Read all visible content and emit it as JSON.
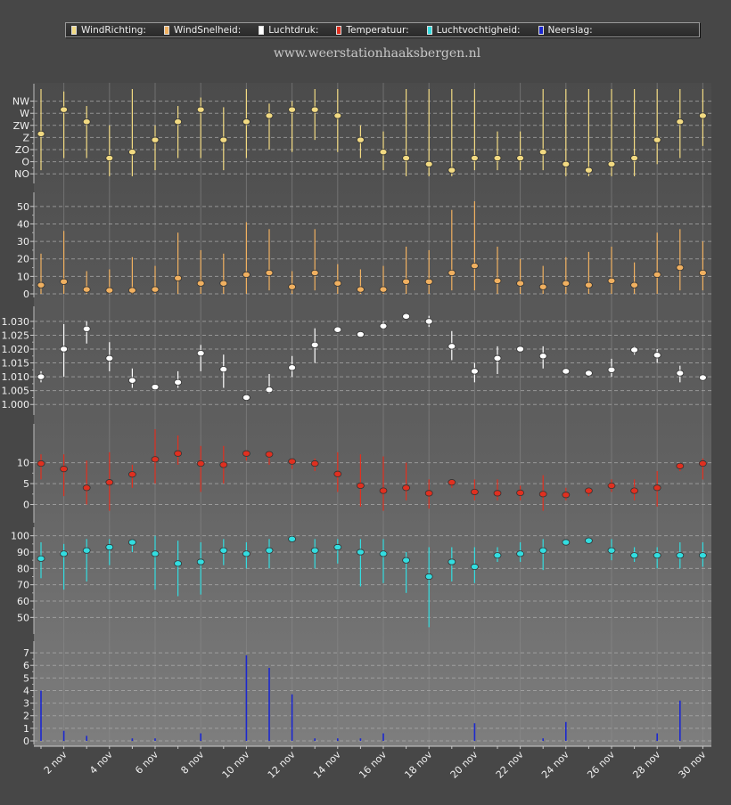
{
  "legend": [
    {
      "label": "WindRichting:",
      "color": "#f2da82"
    },
    {
      "label": "WindSnelheid:",
      "color": "#f0b060"
    },
    {
      "label": "Luchtdruk:",
      "color": "#ffffff"
    },
    {
      "label": "Temperatuur:",
      "color": "#e03020"
    },
    {
      "label": "Luchtvochtigheid:",
      "color": "#33dde0"
    },
    {
      "label": "Neerslag:",
      "color": "#1c28d0"
    }
  ],
  "website": "www.weerstationhaaksbergen.nl",
  "chart_data": {
    "type": "multi-panel",
    "days": [
      1,
      2,
      3,
      4,
      5,
      6,
      7,
      8,
      9,
      10,
      11,
      12,
      13,
      14,
      15,
      16,
      17,
      18,
      19,
      20,
      21,
      22,
      23,
      24,
      25,
      26,
      27,
      28,
      29,
      30
    ],
    "x_tick_labels": [
      {
        "day": 2,
        "label": "2 nov"
      },
      {
        "day": 4,
        "label": "4 nov"
      },
      {
        "day": 6,
        "label": "6 nov"
      },
      {
        "day": 8,
        "label": "8 nov"
      },
      {
        "day": 10,
        "label": "10 nov"
      },
      {
        "day": 12,
        "label": "12 nov"
      },
      {
        "day": 14,
        "label": "14 nov"
      },
      {
        "day": 16,
        "label": "16 nov"
      },
      {
        "day": 18,
        "label": "18 nov"
      },
      {
        "day": 20,
        "label": "20 nov"
      },
      {
        "day": 22,
        "label": "22 nov"
      },
      {
        "day": 24,
        "label": "24 nov"
      },
      {
        "day": 26,
        "label": "26 nov"
      },
      {
        "day": 28,
        "label": "28 nov"
      },
      {
        "day": 30,
        "label": "30 nov"
      }
    ],
    "panels": [
      {
        "name": "WindRichting",
        "color": "#f2da82",
        "categorical_ticks": [
          "NO",
          "O",
          "ZO",
          "Z",
          "ZW",
          "W",
          "NW"
        ],
        "ylim": [
          -0.5,
          7
        ],
        "grid_steps": [
          0,
          1,
          2,
          3,
          4,
          5,
          6
        ],
        "values": [
          3.3,
          5.3,
          4.3,
          1.3,
          1.8,
          2.8,
          4.3,
          5.3,
          2.8,
          4.3,
          4.8,
          5.3,
          5.3,
          4.8,
          2.8,
          1.8,
          1.3,
          0.8,
          0.3,
          1.3,
          1.3,
          1.3,
          1.8,
          0.8,
          0.3,
          0.8,
          1.3,
          2.8,
          4.3,
          4.8
        ],
        "low": [
          0.3,
          1.3,
          1.3,
          -0.2,
          -0.2,
          0.3,
          1.3,
          1.3,
          0.3,
          1.3,
          2.0,
          1.8,
          2.8,
          1.8,
          1.3,
          0.3,
          -0.2,
          -0.2,
          -0.2,
          0.3,
          0.3,
          0.3,
          0.3,
          -0.2,
          -0.2,
          -0.2,
          -0.2,
          0.8,
          1.3,
          2.3
        ],
        "high": [
          7.0,
          6.8,
          5.6,
          4.0,
          7.0,
          4.0,
          5.6,
          6.3,
          5.5,
          7.0,
          5.8,
          6.0,
          7.0,
          7.0,
          4.0,
          3.5,
          7.0,
          7.0,
          7.0,
          7.0,
          3.5,
          3.5,
          7.0,
          7.0,
          7.0,
          7.0,
          7.0,
          7.0,
          7.0,
          7.0
        ]
      },
      {
        "name": "WindSnelheid",
        "color": "#f0b060",
        "ticks": [
          0,
          10,
          20,
          30,
          40,
          50
        ],
        "ylim": [
          0,
          55
        ],
        "values": [
          5,
          7,
          2.5,
          2,
          2,
          2.5,
          9,
          6,
          6,
          11,
          12,
          4,
          12,
          6,
          2.5,
          2.5,
          7,
          7,
          12,
          16,
          7.5,
          6,
          4,
          6,
          5,
          7.5,
          5,
          11,
          15,
          12
        ],
        "low": [
          0,
          0,
          0,
          0,
          0,
          0,
          0,
          0,
          0,
          0,
          2,
          0,
          2,
          0,
          0,
          0,
          0,
          0,
          2,
          2,
          0,
          0,
          0,
          0,
          0,
          0,
          0,
          0,
          2,
          2
        ],
        "high": [
          23,
          36,
          13,
          14,
          21,
          16,
          35,
          25,
          23,
          41,
          37,
          13,
          37,
          17,
          14,
          16,
          27,
          25,
          48,
          53,
          27,
          20,
          16,
          21,
          24,
          27,
          18,
          35,
          37,
          30
        ]
      },
      {
        "name": "Luchtdruk",
        "color": "#ffffff",
        "ticks": [
          1.0,
          1.005,
          1.01,
          1.015,
          1.02,
          1.025,
          1.03
        ],
        "tick_labels": [
          "1.000",
          "1.005",
          "1.010",
          "1.015",
          "1.020",
          "1.025",
          "1.030"
        ],
        "ylim": [
          0.9975,
          1.0335
        ],
        "values": [
          1.01,
          1.02,
          1.0273,
          1.0167,
          1.0087,
          1.0063,
          1.008,
          1.0185,
          1.0127,
          1.0025,
          1.0053,
          1.0133,
          1.0215,
          1.027,
          1.0253,
          1.0283,
          1.0318,
          1.03,
          1.021,
          1.012,
          1.0167,
          1.02,
          1.0175,
          1.012,
          1.0113,
          1.0125,
          1.0197,
          1.0178,
          1.0113,
          1.0097
        ],
        "low": [
          1.008,
          1.01,
          1.022,
          1.012,
          1.006,
          1.0063,
          1.006,
          1.012,
          1.006,
          1.002,
          1.004,
          1.01,
          1.015,
          1.027,
          1.0253,
          1.027,
          1.0318,
          1.028,
          1.016,
          1.008,
          1.011,
          1.02,
          1.013,
          1.012,
          1.0113,
          1.01,
          1.018,
          1.015,
          1.008,
          1.0097
        ],
        "high": [
          1.012,
          1.029,
          1.03,
          1.0225,
          1.013,
          1.0063,
          1.012,
          1.0215,
          1.018,
          1.0025,
          1.011,
          1.0175,
          1.0275,
          1.027,
          1.0253,
          1.03,
          1.0318,
          1.032,
          1.0265,
          1.015,
          1.021,
          1.02,
          1.021,
          1.012,
          1.0113,
          1.0165,
          1.021,
          1.02,
          1.014,
          1.0097
        ]
      },
      {
        "name": "Temperatuur",
        "color": "#e03020",
        "ticks": [
          0,
          5,
          10
        ],
        "ylim": [
          -3.5,
          18
        ],
        "values": [
          9.8,
          8.5,
          4,
          5.3,
          7.2,
          10.8,
          12.2,
          9.8,
          9.5,
          12.2,
          12,
          10.3,
          9.8,
          7.3,
          4.5,
          3.3,
          4,
          2.7,
          5.3,
          3,
          2.7,
          2.8,
          2.5,
          2.3,
          3.3,
          4.5,
          3.3,
          4,
          9.2,
          9.8
        ],
        "low": [
          6,
          2,
          0,
          -1.5,
          4,
          5,
          9.5,
          3,
          5,
          10.5,
          9.5,
          8.5,
          8,
          3,
          -0.5,
          -1.5,
          1,
          -1,
          4,
          1,
          1,
          1,
          -1.5,
          1,
          2,
          3,
          1,
          -0.5,
          8,
          6
        ],
        "high": [
          12,
          12,
          10.5,
          12.5,
          9.5,
          18,
          16.5,
          14,
          14,
          13,
          12.5,
          11,
          11,
          12.5,
          12,
          11.5,
          10,
          6,
          6,
          6,
          6,
          4.5,
          7,
          4,
          4,
          6,
          6,
          8,
          9.8,
          11
        ]
      },
      {
        "name": "Luchtvochtigheid",
        "color": "#33dde0",
        "ticks": [
          50,
          60,
          70,
          80,
          90,
          100
        ],
        "ylim": [
          42,
          102
        ],
        "values": [
          86,
          89,
          91,
          93,
          96,
          89,
          83,
          84,
          91,
          89,
          91,
          98,
          91,
          93,
          90,
          89,
          85,
          75,
          84,
          81,
          88,
          89,
          91,
          96,
          97,
          91,
          88,
          88,
          88,
          88
        ],
        "low": [
          74,
          67,
          72,
          82,
          90,
          67,
          63,
          64,
          82,
          80,
          80,
          98,
          80,
          83,
          69,
          71,
          65,
          44,
          72,
          71,
          84,
          84,
          79,
          96,
          97,
          85,
          84,
          80,
          80,
          81
        ],
        "high": [
          96,
          95,
          98,
          98,
          98,
          100,
          97,
          96,
          98,
          96,
          98,
          100,
          98,
          98,
          98,
          98,
          90,
          93,
          93,
          93,
          93,
          96,
          98,
          96,
          97,
          98,
          93,
          93,
          96,
          96
        ]
      },
      {
        "name": "Neerslag",
        "color": "#1c28d0",
        "ticks": [
          0,
          1,
          2,
          3,
          4,
          5,
          6,
          7
        ],
        "ylim": [
          0,
          7.5
        ],
        "values": [
          4.0,
          0.8,
          0.4,
          0,
          0.2,
          0.2,
          0,
          0.6,
          0,
          6.8,
          5.8,
          3.7,
          0.2,
          0.2,
          0.2,
          0.6,
          0,
          0,
          0,
          1.4,
          0,
          0,
          0.2,
          1.5,
          0,
          0,
          0,
          0.6,
          3.2,
          0
        ]
      }
    ]
  }
}
